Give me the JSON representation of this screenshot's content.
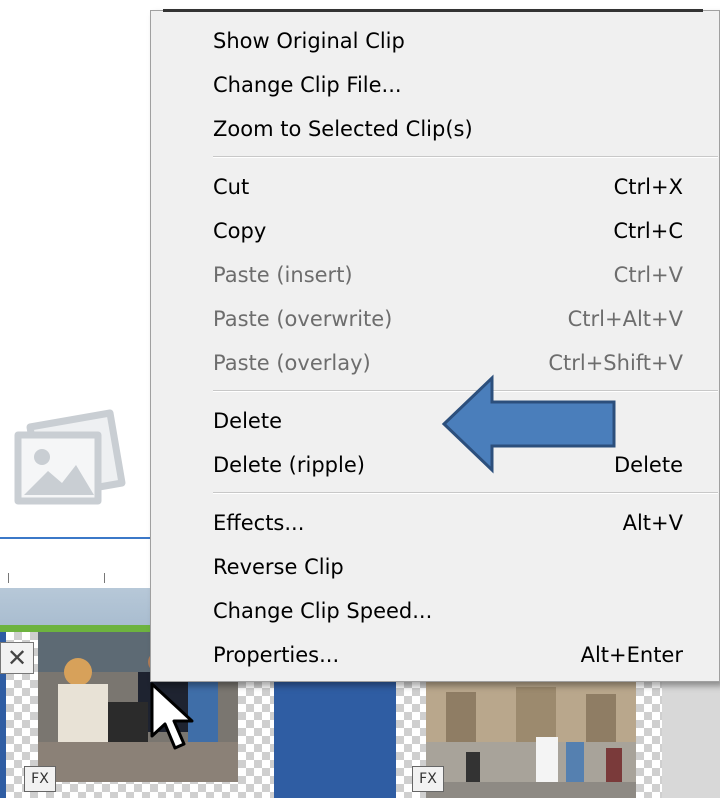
{
  "context_menu": {
    "items": [
      {
        "label": "Show Original Clip",
        "shortcut": "",
        "enabled": true
      },
      {
        "label": "Change Clip File...",
        "shortcut": "",
        "enabled": true
      },
      {
        "label": "Zoom to Selected Clip(s)",
        "shortcut": "",
        "enabled": true
      },
      {
        "label": "Cut",
        "shortcut": "Ctrl+X",
        "enabled": true
      },
      {
        "label": "Copy",
        "shortcut": "Ctrl+C",
        "enabled": true
      },
      {
        "label": "Paste (insert)",
        "shortcut": "Ctrl+V",
        "enabled": false
      },
      {
        "label": "Paste (overwrite)",
        "shortcut": "Ctrl+Alt+V",
        "enabled": false
      },
      {
        "label": "Paste (overlay)",
        "shortcut": "Ctrl+Shift+V",
        "enabled": false
      },
      {
        "label": "Delete",
        "shortcut": "",
        "enabled": true
      },
      {
        "label": "Delete (ripple)",
        "shortcut": "Delete",
        "enabled": true
      },
      {
        "label": "Effects...",
        "shortcut": "Alt+V",
        "enabled": true
      },
      {
        "label": "Reverse Clip",
        "shortcut": "",
        "enabled": true
      },
      {
        "label": "Change Clip Speed...",
        "shortcut": "",
        "enabled": true
      },
      {
        "label": "Properties...",
        "shortcut": "Alt+Enter",
        "enabled": true
      }
    ]
  },
  "timeline": {
    "clips": [
      {
        "fx_label": "FX"
      },
      {
        "fx_label": "FX"
      }
    ],
    "remove_badge_icon": "close-icon"
  },
  "icons": {
    "photo_placeholder": "image-placeholder-icon",
    "cursor": "mouse-pointer-icon",
    "annotation": "left-arrow-icon"
  },
  "colors": {
    "menu_bg": "#f0f0f0",
    "disabled_text": "#6d6d6d",
    "arrow_fill": "#4a7ebb",
    "arrow_stroke": "#2c4f7c",
    "track_blue": "#2f5da3"
  }
}
